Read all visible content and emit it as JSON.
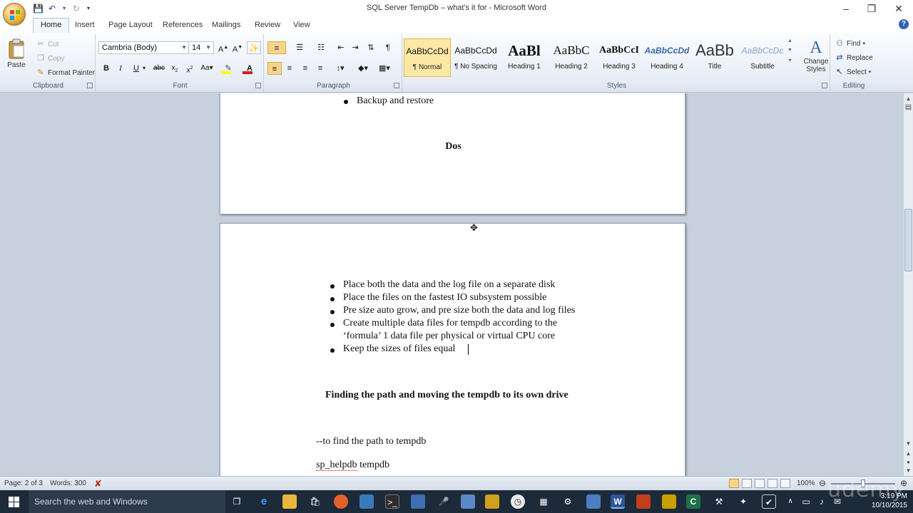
{
  "window": {
    "title": "SQL Server TempDb – what's it for - Microsoft Word"
  },
  "tabs": [
    "Home",
    "Insert",
    "Page Layout",
    "References",
    "Mailings",
    "Review",
    "View"
  ],
  "ribbon": {
    "clipboard": {
      "label": "Clipboard",
      "paste": "Paste",
      "cut": "Cut",
      "copy": "Copy",
      "format_painter": "Format Painter"
    },
    "font": {
      "label": "Font",
      "name": "Cambria (Body)",
      "size": "14"
    },
    "paragraph": {
      "label": "Paragraph"
    },
    "styles": {
      "label": "Styles",
      "items": [
        {
          "sample": "AaBbCcDd",
          "name": "¶ Normal"
        },
        {
          "sample": "AaBbCcDd",
          "name": "¶ No Spacing"
        },
        {
          "sample": "AaBl",
          "name": "Heading 1"
        },
        {
          "sample": "AaBbC",
          "name": "Heading 2"
        },
        {
          "sample": "AaBbCcI",
          "name": "Heading 3"
        },
        {
          "sample": "AaBbCcDd",
          "name": "Heading 4"
        },
        {
          "sample": "AaBb",
          "name": "Title"
        },
        {
          "sample": "AaBbCcDc",
          "name": "Subtitle"
        }
      ],
      "change_styles": "Change Styles"
    },
    "editing": {
      "label": "Editing",
      "find": "Find",
      "replace": "Replace",
      "select": "Select"
    }
  },
  "document": {
    "page1": {
      "bullet_top": "Backup and restore",
      "heading": "Dos"
    },
    "page2": {
      "bullets": [
        "Place both the data and the log file on a separate disk",
        "Place the files on the fastest IO subsystem possible",
        "Pre size auto grow, and pre size both the data and log files",
        "Create multiple data files for tempdb according to the",
        "Keep the sizes of files equal"
      ],
      "bullet4_cont": "‘formula’ 1 data file per physical or virtual CPU core",
      "heading": "Finding the path and moving the tempdb to its own drive",
      "comment": "--to find the path to tempdb",
      "code_a": "sp_helpdb",
      "code_b": " tempdb"
    }
  },
  "status": {
    "page": "Page: 2 of 3",
    "words": "Words: 300",
    "zoom": "100%"
  },
  "taskbar": {
    "search_placeholder": "Search the web and Windows",
    "time": "3:19 PM",
    "date": "10/10/2015"
  },
  "watermark": "udemy",
  "colors": {
    "font_color": "#d0201a",
    "highlight": "#ffff00",
    "accent": "#2b579a"
  }
}
